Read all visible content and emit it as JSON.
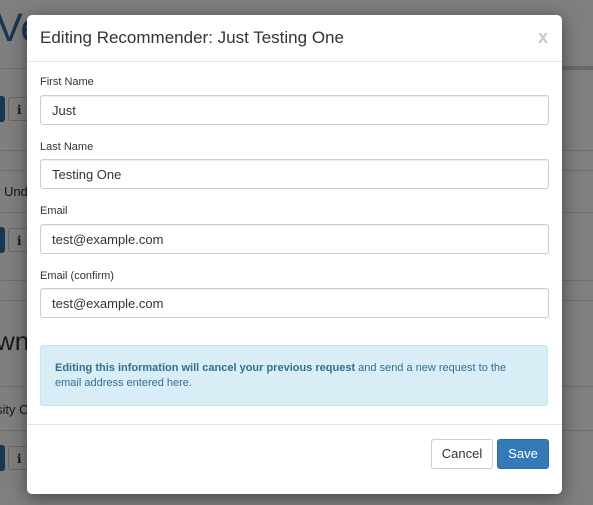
{
  "background": {
    "heading_fragment": "Ve",
    "row_text_1": "r Und",
    "subheading_fragment": "wn I",
    "row_text_2": "sity O",
    "info_icon_label": "i"
  },
  "modal": {
    "title": "Editing Recommender: Just Testing One",
    "close_label": "x",
    "fields": {
      "first_name": {
        "label": "First Name",
        "value": "Just"
      },
      "last_name": {
        "label": "Last Name",
        "value": "Testing One"
      },
      "email": {
        "label": "Email",
        "value": "test@example.com"
      },
      "email_confirm": {
        "label": "Email (confirm)",
        "value": "test@example.com"
      }
    },
    "alert": {
      "bold_text": "Editing this information will cancel your previous request",
      "rest_text": " and send a new request to the email address entered here."
    },
    "buttons": {
      "cancel": "Cancel",
      "save": "Save"
    }
  },
  "colors": {
    "primary": "#337ab7",
    "alert_bg": "#d9edf7",
    "alert_text": "#31708f"
  }
}
